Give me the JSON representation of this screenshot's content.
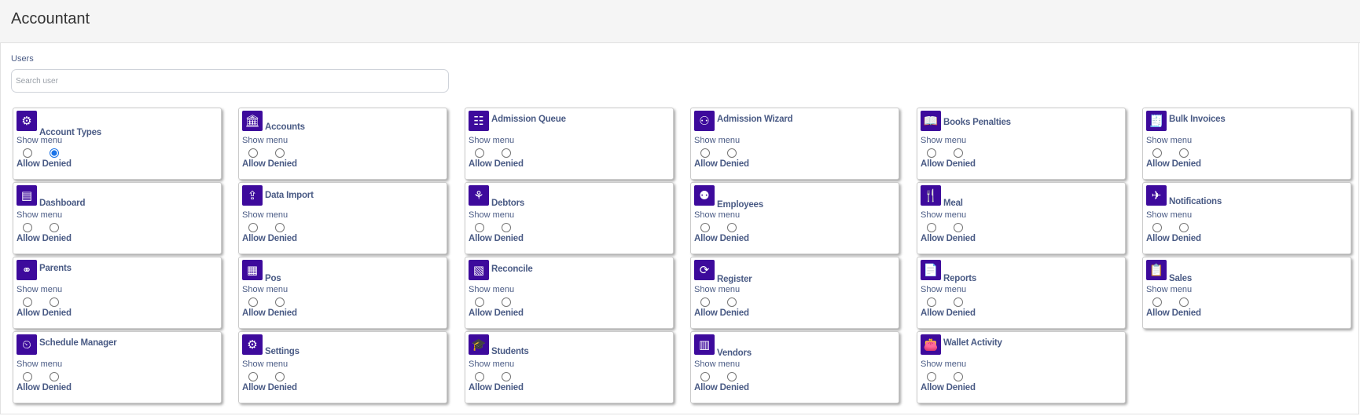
{
  "page": {
    "title": "Accountant"
  },
  "users": {
    "label": "Users",
    "search_placeholder": "Search user"
  },
  "common": {
    "show_menu": "Show menu",
    "allow": "Allow",
    "denied": "Denied"
  },
  "permissions": [
    {
      "name": "Account Types",
      "icon": "money-gear-icon",
      "glyph": "⚙",
      "selected": "denied"
    },
    {
      "name": "Accounts",
      "icon": "bank-icon",
      "glyph": "🏛",
      "selected": null
    },
    {
      "name": "Admission Queue",
      "icon": "admission-queue-icon",
      "glyph": "☷",
      "selected": null
    },
    {
      "name": "Admission Wizard",
      "icon": "admission-wizard-icon",
      "glyph": "⚇",
      "selected": null
    },
    {
      "name": "Books Penalties",
      "icon": "book-icon",
      "glyph": "📖",
      "selected": null
    },
    {
      "name": "Bulk Invoices",
      "icon": "invoice-icon",
      "glyph": "🧾",
      "selected": null
    },
    {
      "name": "Dashboard",
      "icon": "dashboard-icon",
      "glyph": "▤",
      "selected": null
    },
    {
      "name": "Data Import",
      "icon": "data-import-icon",
      "glyph": "⇪",
      "selected": null
    },
    {
      "name": "Debtors",
      "icon": "debtors-icon",
      "glyph": "⚘",
      "selected": null
    },
    {
      "name": "Employees",
      "icon": "employees-icon",
      "glyph": "⚉",
      "selected": null
    },
    {
      "name": "Meal",
      "icon": "meal-icon",
      "glyph": "🍴",
      "selected": null
    },
    {
      "name": "Notifications",
      "icon": "paper-plane-icon",
      "glyph": "✈",
      "selected": null
    },
    {
      "name": "Parents",
      "icon": "parents-icon",
      "glyph": "⚭",
      "selected": null
    },
    {
      "name": "Pos",
      "icon": "cash-register-icon",
      "glyph": "▦",
      "selected": null
    },
    {
      "name": "Reconcile",
      "icon": "calculator-icon",
      "glyph": "▧",
      "selected": null
    },
    {
      "name": "Register",
      "icon": "register-icon",
      "glyph": "⟳",
      "selected": null
    },
    {
      "name": "Reports",
      "icon": "reports-icon",
      "glyph": "📄",
      "selected": null
    },
    {
      "name": "Sales",
      "icon": "sales-icon",
      "glyph": "📋",
      "selected": null
    },
    {
      "name": "Schedule Manager",
      "icon": "schedule-icon",
      "glyph": "⏲",
      "selected": null
    },
    {
      "name": "Settings",
      "icon": "gear-icon",
      "glyph": "⚙",
      "selected": null
    },
    {
      "name": "Students",
      "icon": "graduation-cap-icon",
      "glyph": "🎓",
      "selected": null
    },
    {
      "name": "Vendors",
      "icon": "vendor-icon",
      "glyph": "▥",
      "selected": null
    },
    {
      "name": "Wallet Activity",
      "icon": "wallet-icon",
      "glyph": "👛",
      "selected": null
    }
  ]
}
